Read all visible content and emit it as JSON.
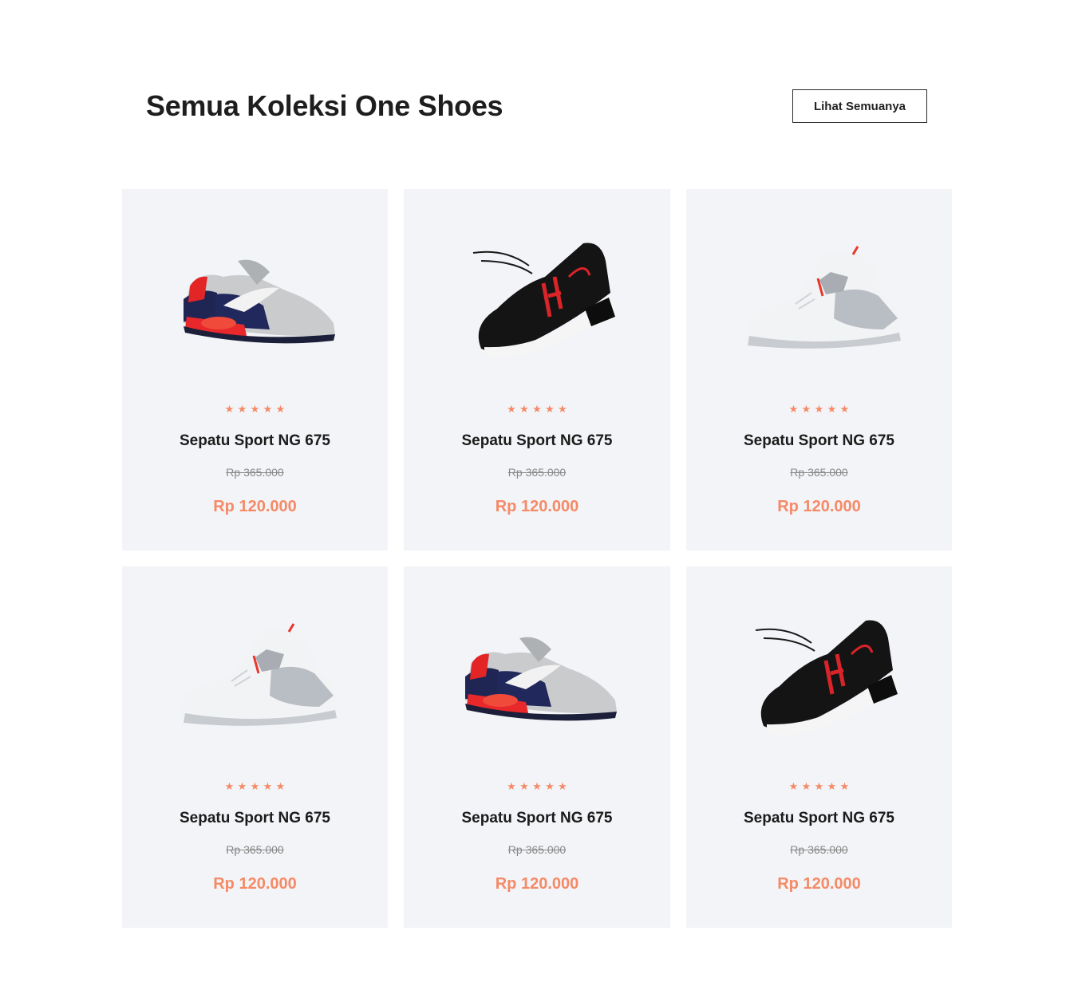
{
  "section": {
    "title": "Semua Koleksi One Shoes",
    "view_all_label": "Lihat Semuanya"
  },
  "colors": {
    "accent": "#f58a67",
    "card_bg": "#f3f4f7"
  },
  "products": [
    {
      "name": "Sepatu Sport NG 675",
      "old_price": "Rp 365.000",
      "price": "Rp 120.000",
      "rating": 5,
      "image": "shoe-airmax-red-navy"
    },
    {
      "name": "Sepatu Sport NG 675",
      "old_price": "Rp 365.000",
      "price": "Rp 120.000",
      "rating": 5,
      "image": "shoe-black-red"
    },
    {
      "name": "Sepatu Sport NG 675",
      "old_price": "Rp 365.000",
      "price": "Rp 120.000",
      "rating": 5,
      "image": "shoe-white-grey"
    },
    {
      "name": "Sepatu Sport NG 675",
      "old_price": "Rp 365.000",
      "price": "Rp 120.000",
      "rating": 5,
      "image": "shoe-white-grey"
    },
    {
      "name": "Sepatu Sport NG 675",
      "old_price": "Rp 365.000",
      "price": "Rp 120.000",
      "rating": 5,
      "image": "shoe-airmax-red-navy"
    },
    {
      "name": "Sepatu Sport NG 675",
      "old_price": "Rp 365.000",
      "price": "Rp 120.000",
      "rating": 5,
      "image": "shoe-black-red"
    }
  ]
}
